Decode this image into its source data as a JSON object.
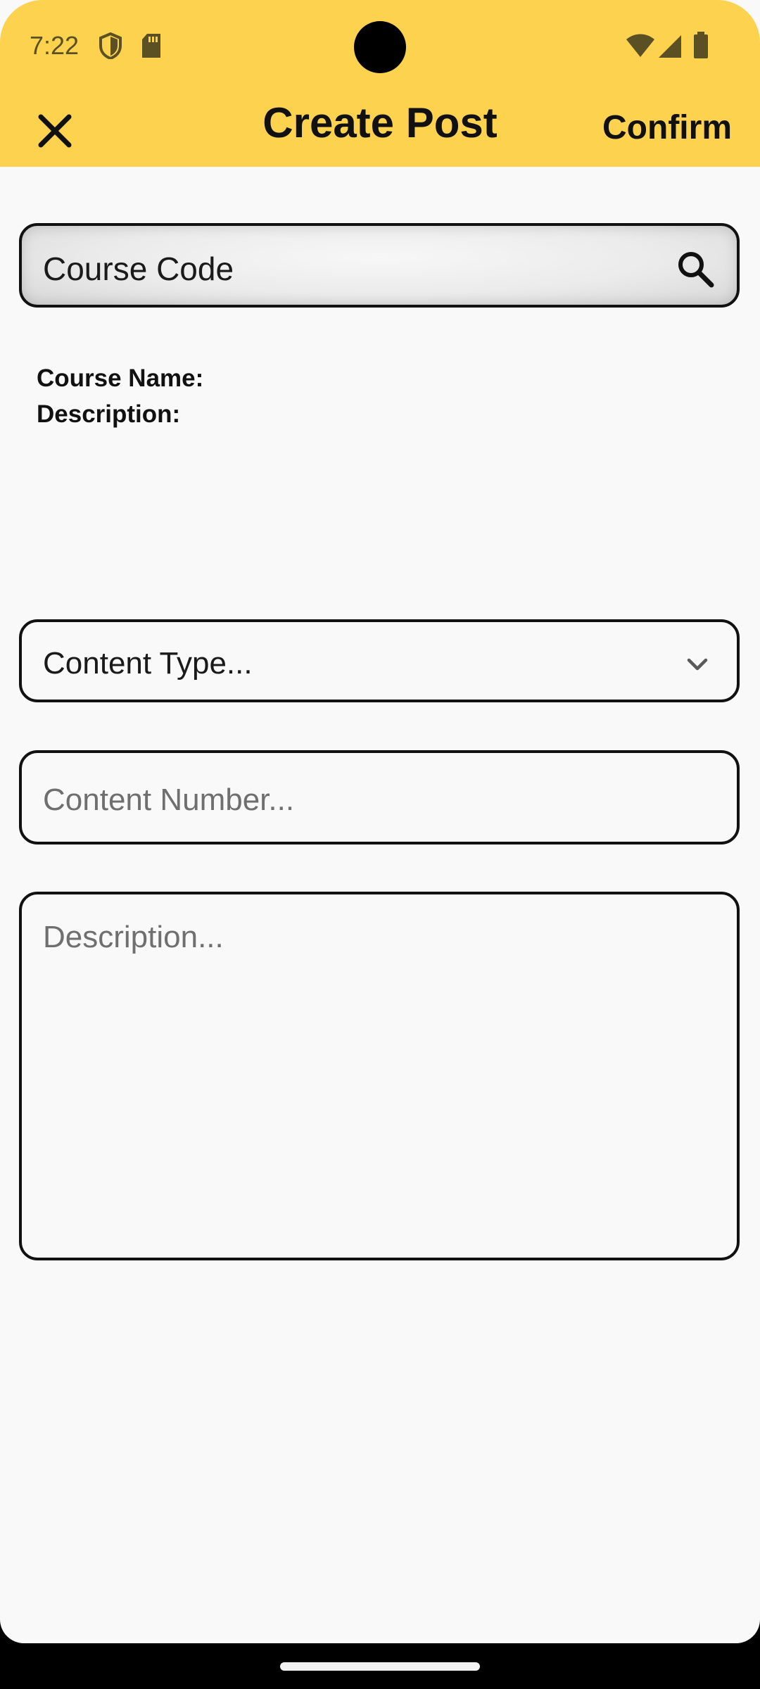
{
  "status_bar": {
    "time": "7:22",
    "icons_left": [
      "shield-icon",
      "sd-card-icon"
    ],
    "icons_right": [
      "wifi-icon",
      "signal-icon",
      "battery-icon"
    ]
  },
  "app_bar": {
    "close_icon": "close-icon",
    "title": "Create Post",
    "confirm_label": "Confirm"
  },
  "search": {
    "value": "Course Code",
    "icon": "search-icon"
  },
  "course_info": {
    "name_label": "Course Name:",
    "description_label": "Description:"
  },
  "form": {
    "content_type_placeholder": "Content Type...",
    "content_number_placeholder": "Content Number...",
    "description_placeholder": "Description..."
  },
  "colors": {
    "accent": "#fdd24e",
    "background": "#f9f9f9",
    "border": "#111111",
    "placeholder": "#6f6f6f"
  }
}
